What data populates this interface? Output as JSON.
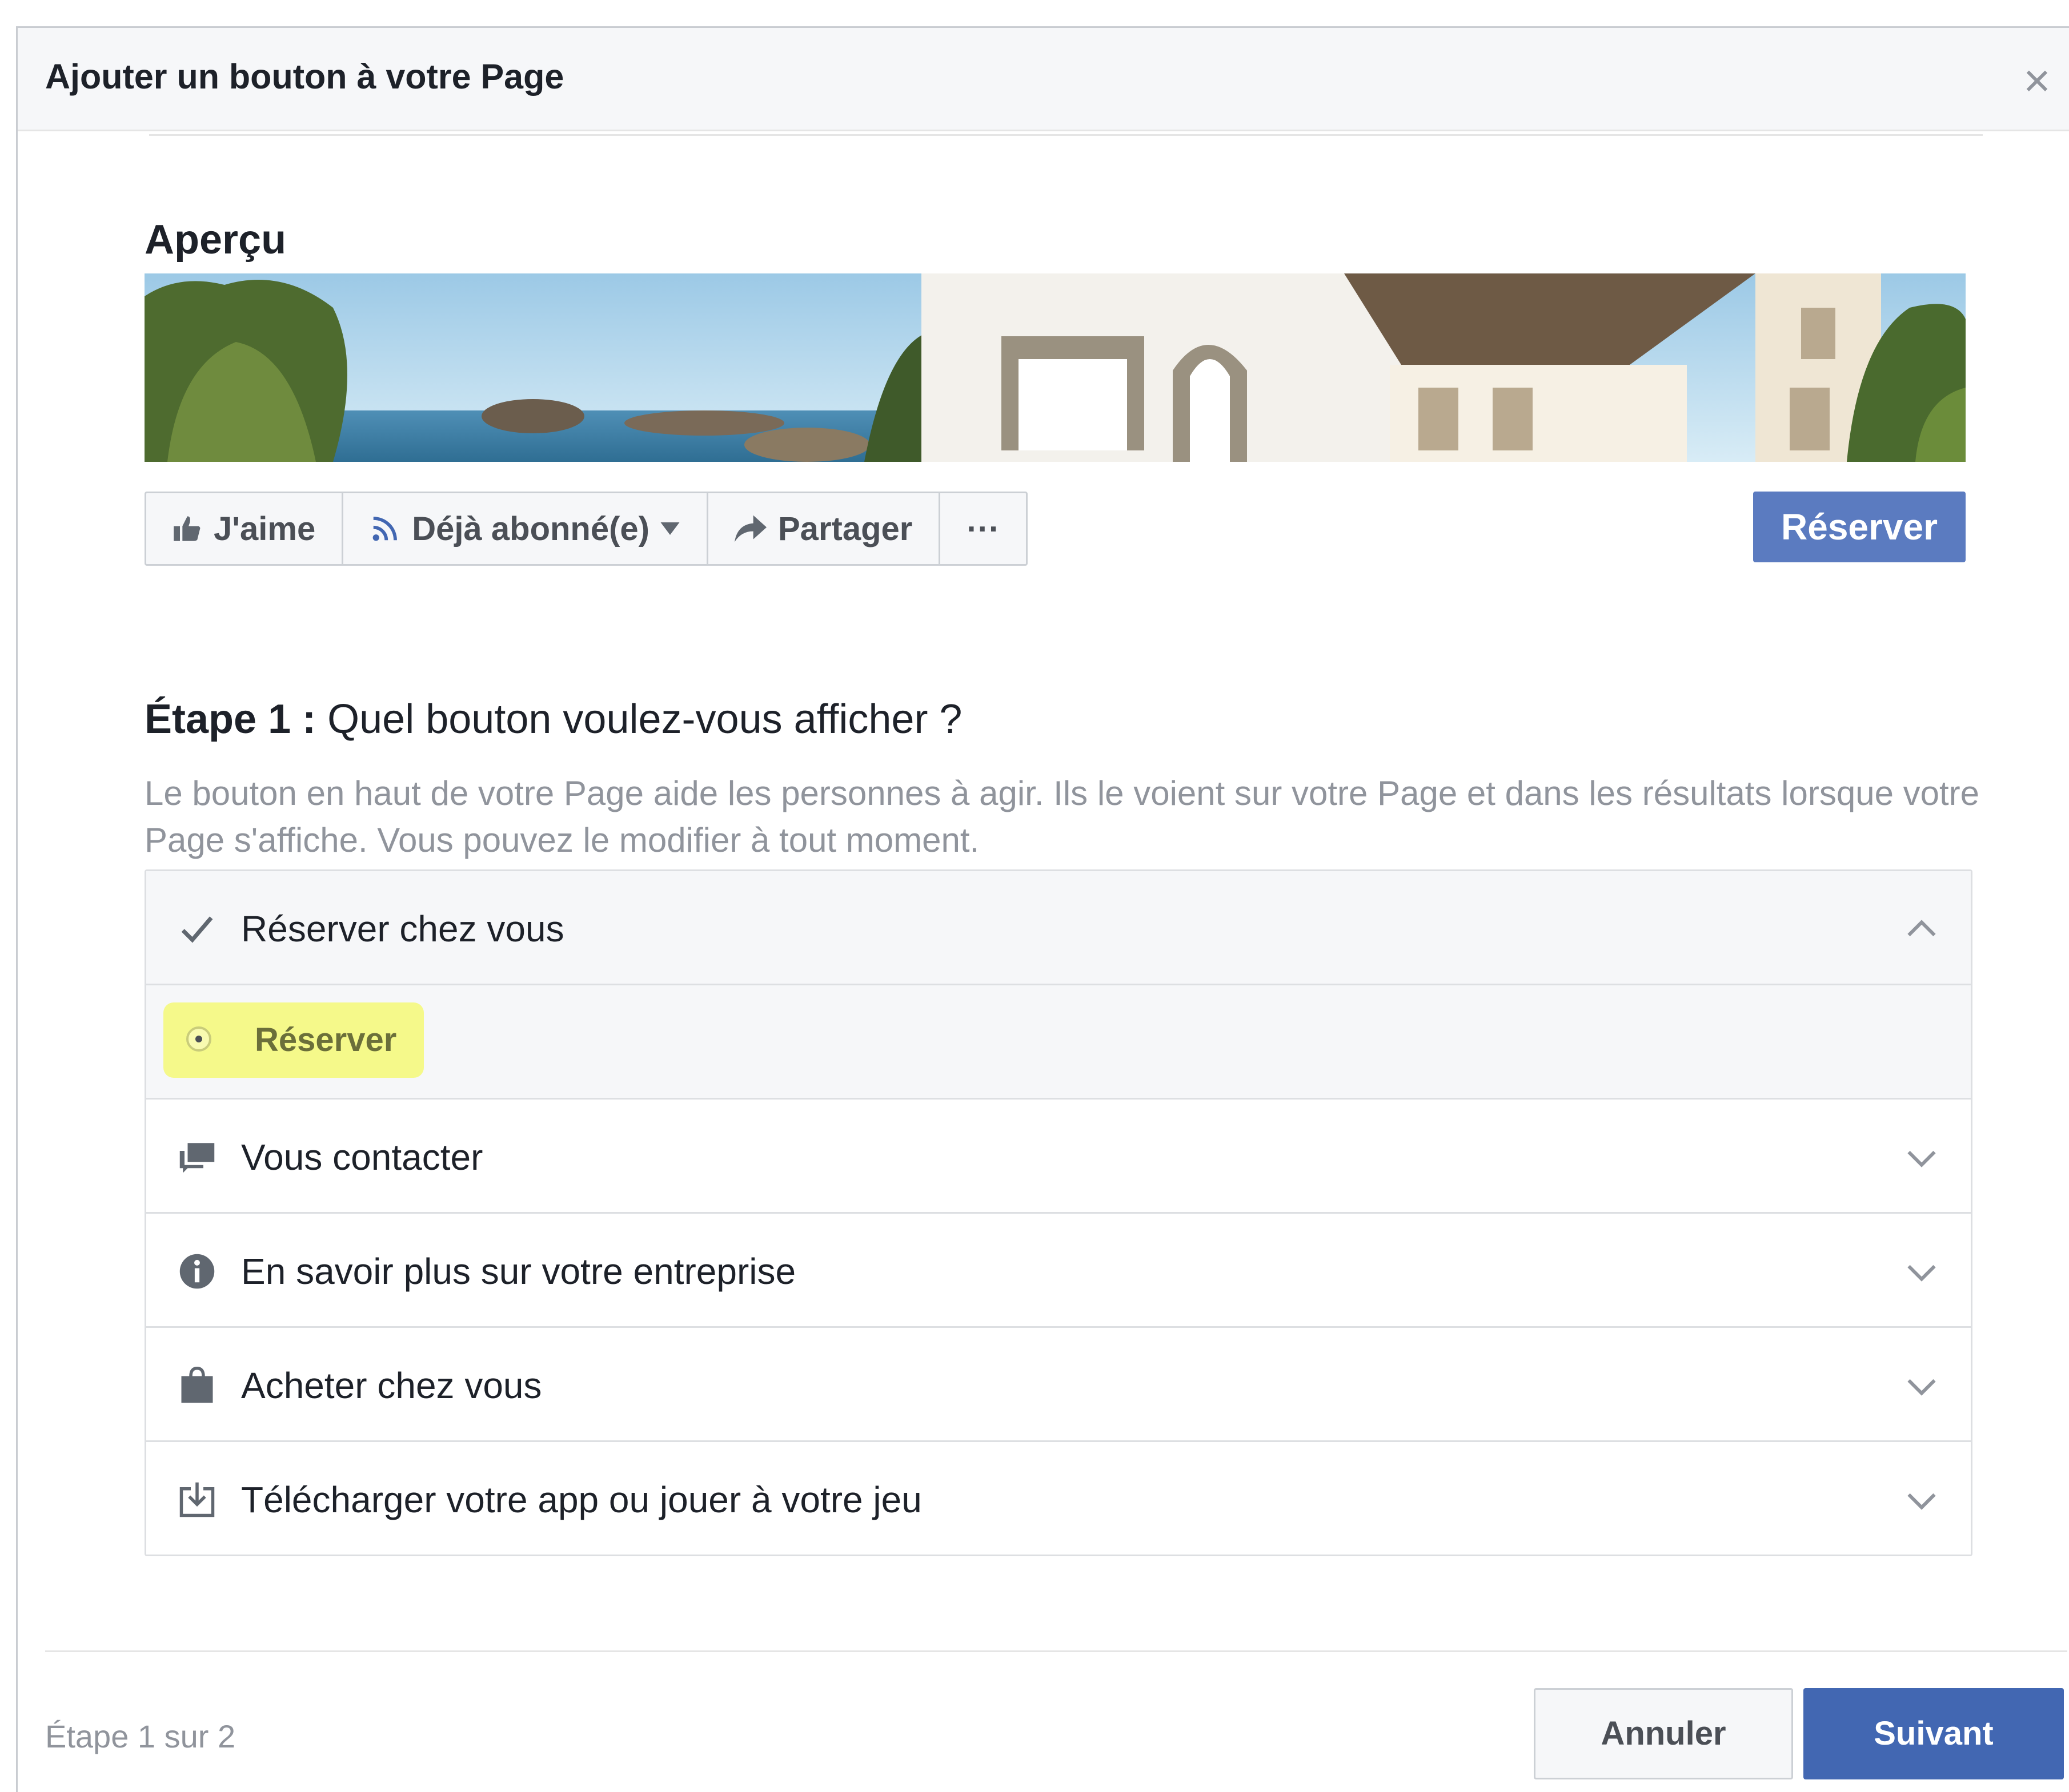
{
  "dialog": {
    "title": "Ajouter un bouton à votre Page",
    "close_icon": "close-icon"
  },
  "preview": {
    "title": "Aperçu",
    "actions": [
      {
        "label": "J'aime",
        "icon": "thumbs-up-icon"
      },
      {
        "label": "Déjà abonné(e)",
        "icon": "rss-icon"
      },
      {
        "label": "Partager",
        "icon": "share-icon"
      },
      {
        "label": "···",
        "icon": "more-icon"
      }
    ],
    "cta_label": "Réserver"
  },
  "step": {
    "label": "Étape 1 :",
    "question": "Quel bouton voulez-vous afficher ?",
    "description": "Le bouton en haut de votre Page aide les personnes à agir. Ils le voient sur votre Page et dans les résultats lorsque votre Page s'affiche. Vous pouvez le modifier à tout moment."
  },
  "options": [
    {
      "label": "Réserver chez vous",
      "icon": "check-icon",
      "expanded": true,
      "sub": [
        {
          "label": "Réserver",
          "selected": true
        }
      ]
    },
    {
      "label": "Vous contacter",
      "icon": "chat-icon",
      "expanded": false
    },
    {
      "label": "En savoir plus sur votre entreprise",
      "icon": "info-icon",
      "expanded": false
    },
    {
      "label": "Acheter chez vous",
      "icon": "bag-icon",
      "expanded": false
    },
    {
      "label": "Télécharger votre app ou jouer à votre jeu",
      "icon": "download-icon",
      "expanded": false
    }
  ],
  "footer": {
    "step_indicator": "Étape 1 sur 2",
    "cancel_label": "Annuler",
    "next_label": "Suivant"
  },
  "colors": {
    "primary": "#4267b2",
    "preview_cta": "#5b7bc0",
    "highlight": "#f5f98a"
  }
}
